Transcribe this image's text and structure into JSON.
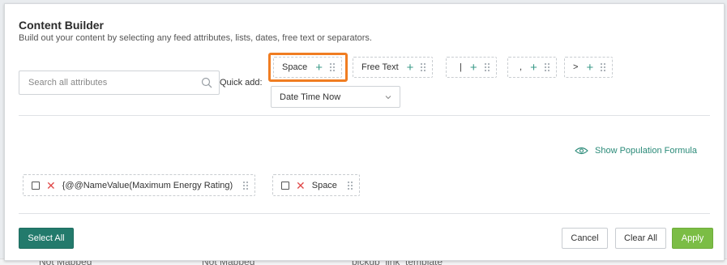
{
  "background_row": {
    "cells": [
      "Not Mapped",
      "Not Mapped",
      "bickup_link_template"
    ]
  },
  "dialog": {
    "title": "Content Builder",
    "subtitle": "Build out your content by selecting any feed attributes, lists, dates, free text or separators."
  },
  "search": {
    "placeholder": "Search all attributes",
    "value": "",
    "icon": "search-icon"
  },
  "quick_add": {
    "label": "Quick add:",
    "chips": [
      {
        "label": "Space",
        "highlighted": true
      },
      {
        "label": "Free Text",
        "highlighted": false
      },
      {
        "label": "|",
        "highlighted": false
      },
      {
        "label": ",",
        "highlighted": false
      },
      {
        "label": ">",
        "highlighted": false
      }
    ],
    "date_dropdown": {
      "selected": "Date Time Now"
    }
  },
  "formula_link": {
    "label": "Show Population Formula",
    "icon": "eye-icon"
  },
  "tokens": [
    {
      "label": "{@@NameValue(Maximum Energy Rating)",
      "checked": false
    },
    {
      "label": "Space",
      "checked": false
    }
  ],
  "footer": {
    "select_all": "Select All",
    "cancel": "Cancel",
    "clear_all": "Clear All",
    "apply": "Apply"
  },
  "colors": {
    "accent_teal": "#237a6c",
    "link_teal": "#2a8a78",
    "apply_green": "#7bbd45",
    "highlight_orange": "#f07d22",
    "remove_red": "#e04a4a"
  }
}
